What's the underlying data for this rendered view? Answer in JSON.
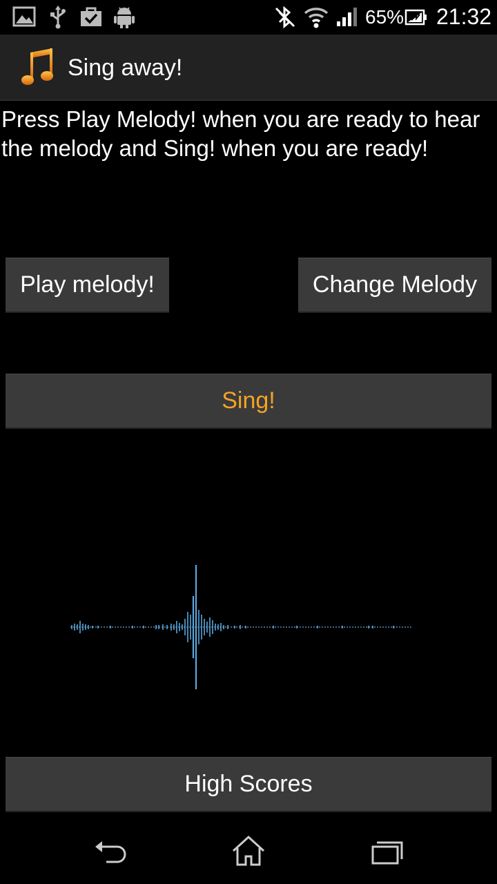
{
  "status_bar": {
    "icons": [
      "image-icon",
      "usb-icon",
      "checkbox-bag-icon",
      "android-icon",
      "bluetooth-off-icon",
      "wifi-icon",
      "signal-icon",
      "battery-charging-icon"
    ],
    "battery_percent": "65%",
    "time": "21:32"
  },
  "action_bar": {
    "title": "Sing away!",
    "icon": "music-note-icon",
    "icon_color": "#f08a1c"
  },
  "instructions": "Press Play Melody! when you are ready to hear the melody and Sing! when you are ready!",
  "buttons": {
    "play_melody": "Play melody!",
    "change_melody": "Change Melody",
    "sing": "Sing!",
    "high_scores": "High Scores"
  },
  "colors": {
    "sing_accent": "#f4a324",
    "waveform": "#5aa8e0",
    "button_bg": "#3a3a3a"
  },
  "nav_bar": {
    "items": [
      "back-icon",
      "home-icon",
      "recent-apps-icon"
    ]
  }
}
